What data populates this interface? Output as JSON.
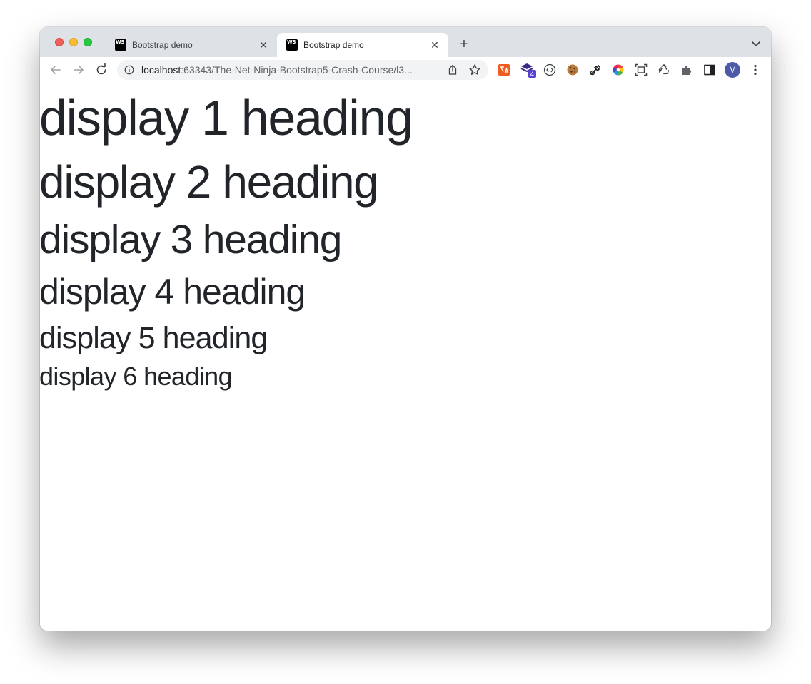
{
  "browser": {
    "tabs": [
      {
        "title": "Bootstrap demo",
        "active": false
      },
      {
        "title": "Bootstrap demo",
        "active": true
      }
    ],
    "close_glyph": "✕",
    "new_tab_glyph": "+",
    "url_host": "localhost",
    "url_rest": ":63343/The-Net-Ninja-Bootstrap5-Crash-Course/l3...",
    "avatar_letter": "M",
    "extension_badge": "4",
    "colors": {
      "tabstrip": "#dee1e6",
      "omnibox": "#f1f3f4",
      "avatar": "#4c5aa8",
      "text": "#212529"
    },
    "icons": [
      "back-arrow-icon",
      "forward-arrow-icon",
      "reload-icon",
      "site-info-icon",
      "share-icon",
      "bookmark-star-icon",
      "translate-extension-icon",
      "layers-extension-icon",
      "code-extension-icon",
      "cookie-extension-icon",
      "eyedropper-extension-icon",
      "color-wheel-extension-icon",
      "screenshot-extension-icon",
      "recycle-extension-icon",
      "puzzle-extensions-icon",
      "side-panel-icon",
      "kebab-menu-icon",
      "tab-search-chevron-icon"
    ]
  },
  "page": {
    "headings": [
      "display 1 heading",
      "display 2 heading",
      "display 3 heading",
      "display 4 heading",
      "display 5 heading",
      "display 6 heading"
    ]
  }
}
